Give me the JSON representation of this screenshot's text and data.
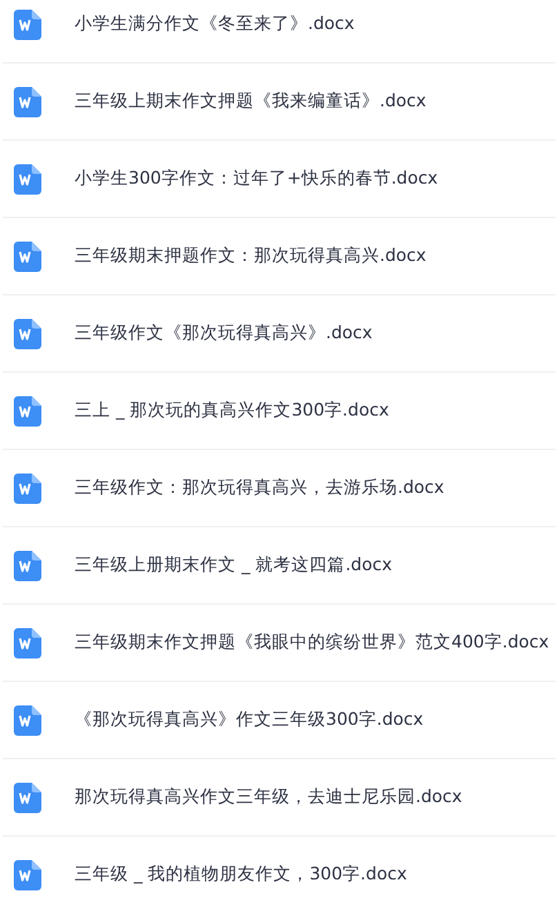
{
  "files": [
    {
      "name": "小学生满分作文《冬至来了》.docx",
      "kind": "word"
    },
    {
      "name": "三年级上期末作文押题《我来编童话》.docx",
      "kind": "word"
    },
    {
      "name": "小学生300字作文：过年了+快乐的春节.docx",
      "kind": "word"
    },
    {
      "name": "三年级期末押题作文：那次玩得真高兴.docx",
      "kind": "word"
    },
    {
      "name": "三年级作文《那次玩得真高兴》.docx",
      "kind": "word"
    },
    {
      "name": "三上 _ 那次玩的真高兴作文300字.docx",
      "kind": "word"
    },
    {
      "name": "三年级作文：那次玩得真高兴，去游乐场.docx",
      "kind": "word"
    },
    {
      "name": "三年级上册期末作文 _ 就考这四篇.docx",
      "kind": "word"
    },
    {
      "name": "三年级期末作文押题《我眼中的缤纷世界》范文400字.docx",
      "kind": "word"
    },
    {
      "name": "《那次玩得真高兴》作文三年级300字.docx",
      "kind": "word"
    },
    {
      "name": "那次玩得真高兴作文三年级，去迪士尼乐园.docx",
      "kind": "word"
    },
    {
      "name": "三年级 _ 我的植物朋友作文，300字.docx",
      "kind": "word"
    }
  ]
}
